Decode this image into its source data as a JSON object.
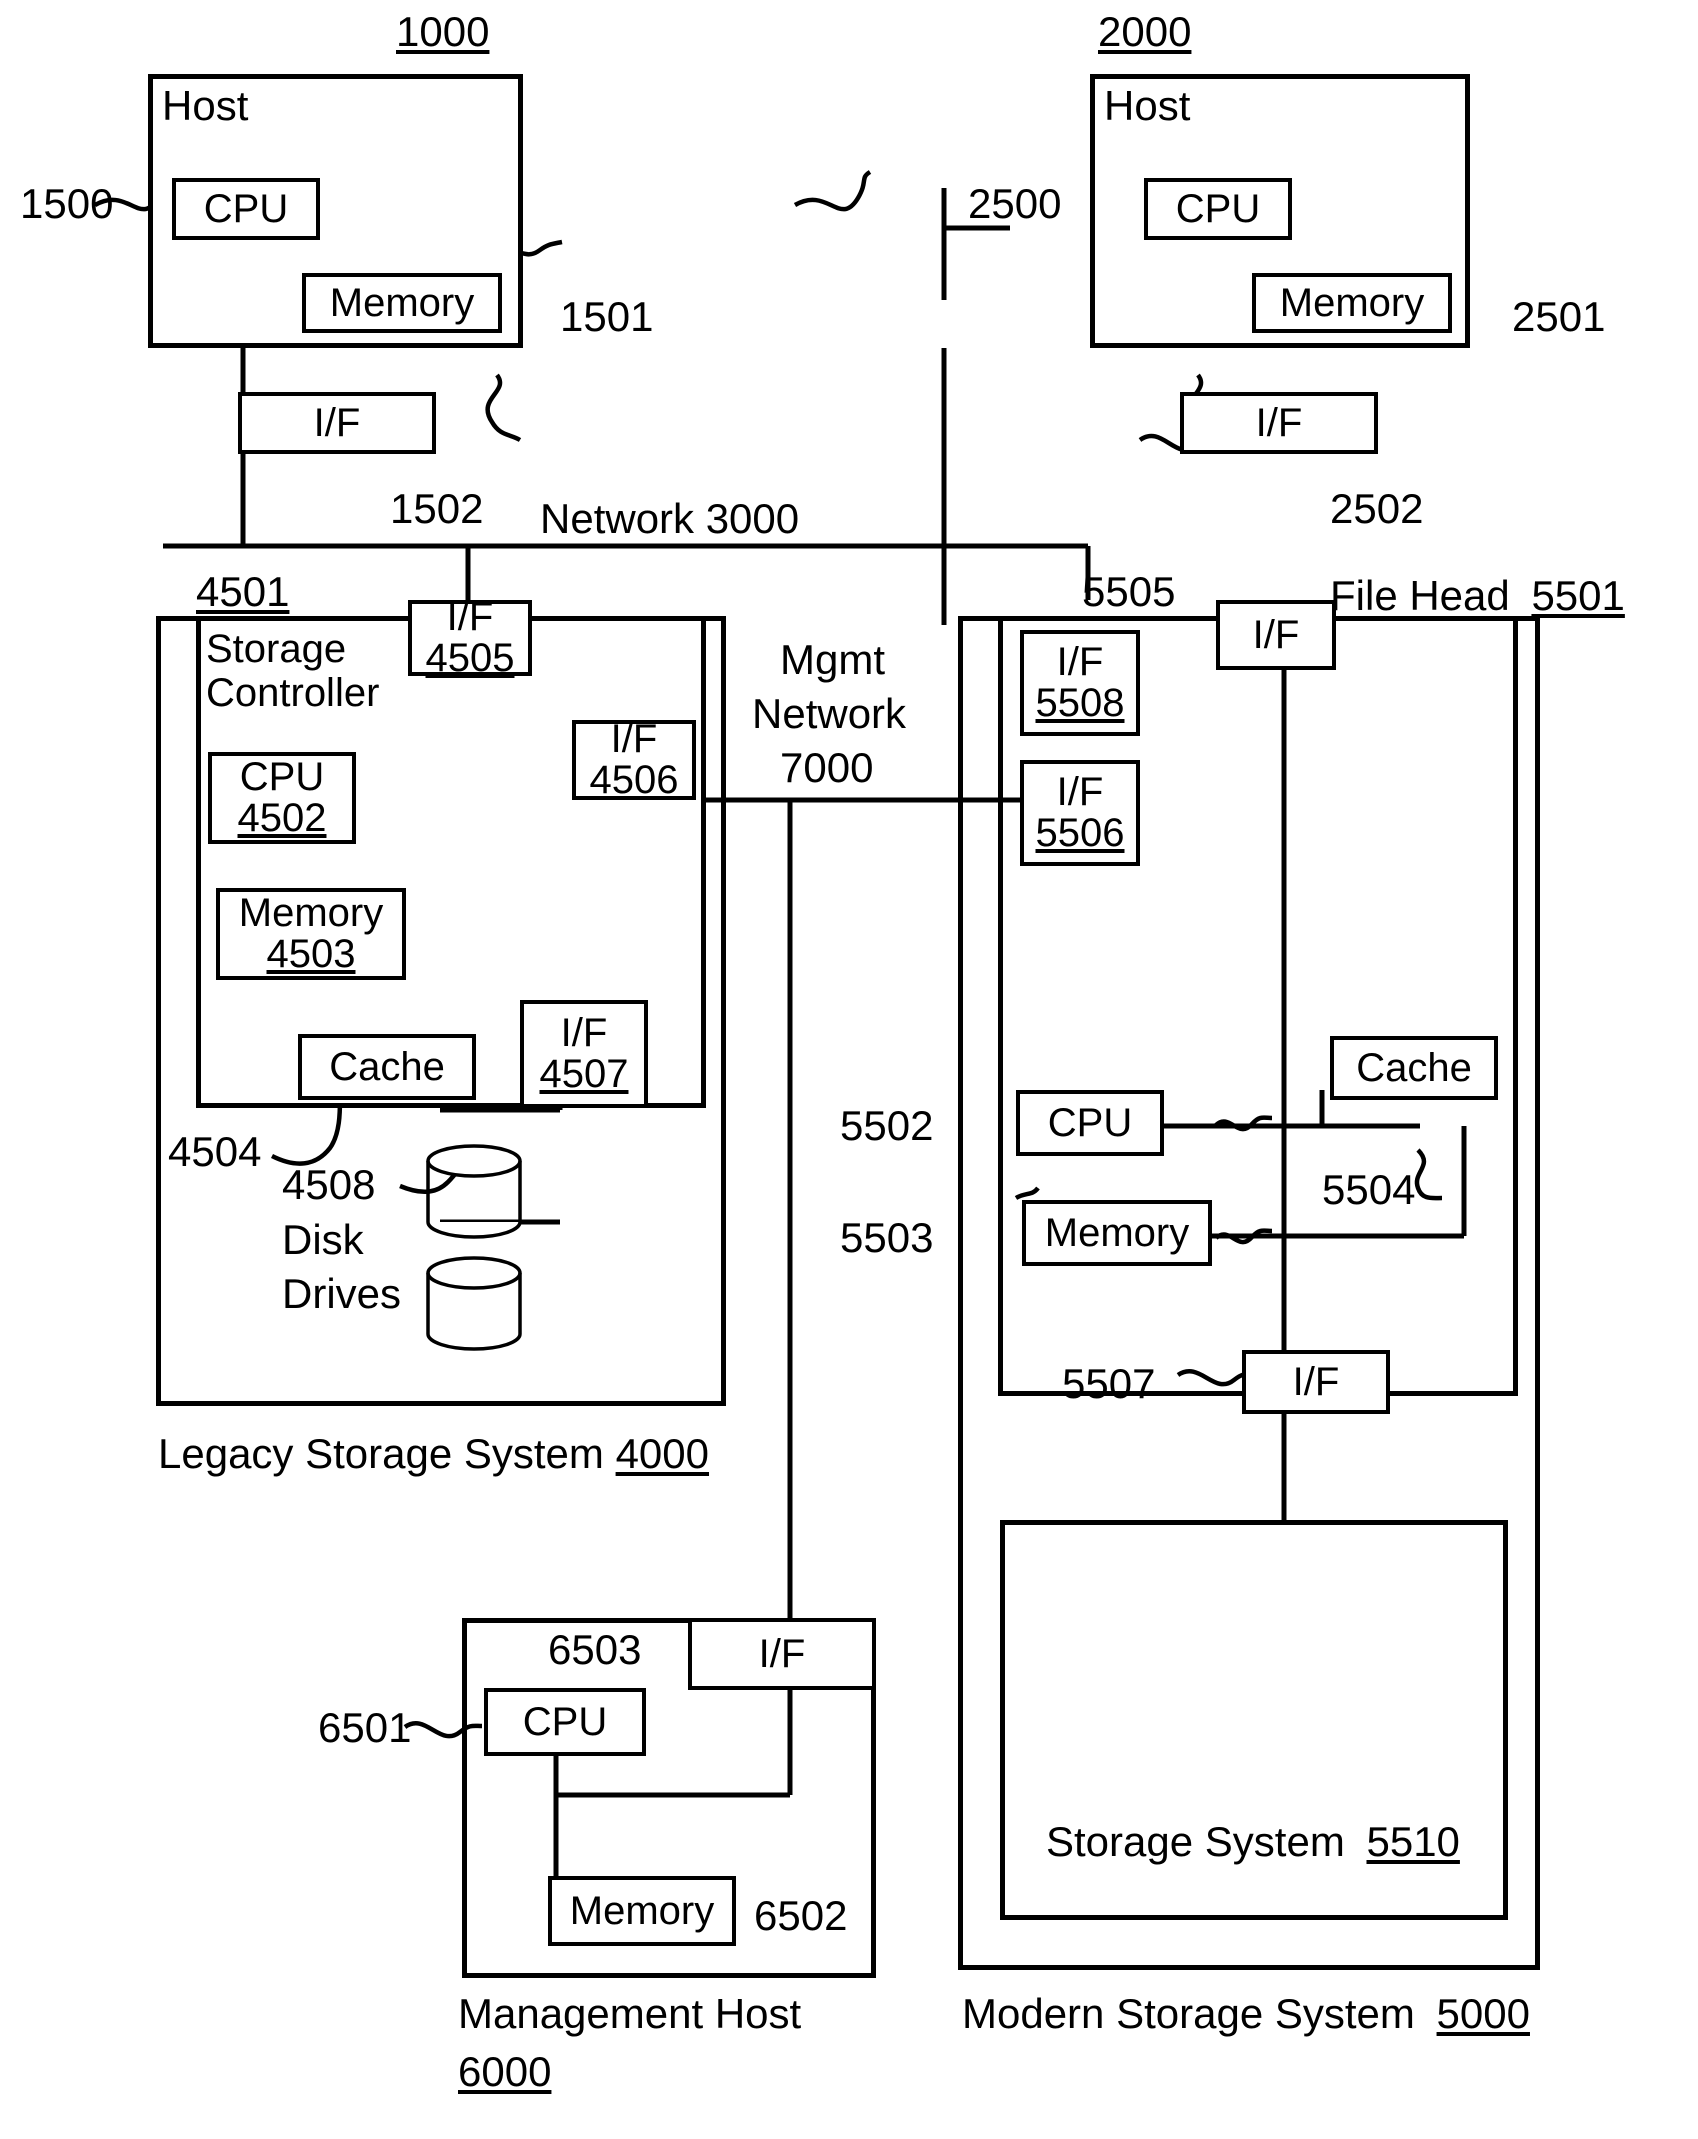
{
  "figure": {
    "type": "patent-block-diagram",
    "description": "Storage system architecture with two hosts, a legacy storage system, a modern storage system with file head, and a management host"
  },
  "hosts": [
    {
      "ref": "1000",
      "title": "Host",
      "callout": "1500",
      "cpu": "CPU",
      "memory": "Memory",
      "memory_ref": "1501",
      "iface": "I/F",
      "iface_ref": "1502"
    },
    {
      "ref": "2000",
      "title": "Host",
      "callout": "2500",
      "cpu": "CPU",
      "memory": "Memory",
      "memory_ref": "2501",
      "iface": "I/F",
      "iface_ref": "2502"
    }
  ],
  "networks": {
    "main": "Network 3000",
    "mgmt_line1": "Mgmt",
    "mgmt_line2": "Network",
    "mgmt_line3": "7000"
  },
  "legacy": {
    "system_label": "Legacy Storage System",
    "system_ref": "4000",
    "controller_ref": "4501",
    "controller_line1": "Storage",
    "controller_line2": "Controller",
    "cpu_label": "CPU",
    "cpu_ref": "4502",
    "memory_label": "Memory",
    "memory_ref": "4503",
    "cache_label": "Cache",
    "cache_ref": "4504",
    "if_a_label": "I/F",
    "if_a_ref": "4505",
    "if_b_label": "I/F",
    "if_b_ref": "4506",
    "if_c_label": "I/F",
    "if_c_ref": "4507",
    "disk_ref": "4508",
    "disk_line1": "Disk",
    "disk_line2": "Drives"
  },
  "modern": {
    "system_label": "Modern Storage System",
    "system_ref": "5000",
    "filehead_label": "File Head",
    "filehead_ref": "5501",
    "if_top_label": "I/F",
    "if_top_ref": "5505",
    "if_5508_label": "I/F",
    "if_5508_ref": "5508",
    "if_5506_label": "I/F",
    "if_5506_ref": "5506",
    "cpu_label": "CPU",
    "cpu_ref": "5502",
    "memory_label": "Memory",
    "memory_ref": "5503",
    "cache_label": "Cache",
    "cache_ref": "5504",
    "if_bottom_label": "I/F",
    "if_bottom_ref": "5507",
    "inner_storage_label": "Storage System",
    "inner_storage_ref": "5510"
  },
  "management": {
    "system_label": "Management Host",
    "system_ref": "6000",
    "cpu_label": "CPU",
    "cpu_ref": "6501",
    "memory_label": "Memory",
    "memory_ref": "6502",
    "if_label": "I/F",
    "if_ref": "6503"
  }
}
